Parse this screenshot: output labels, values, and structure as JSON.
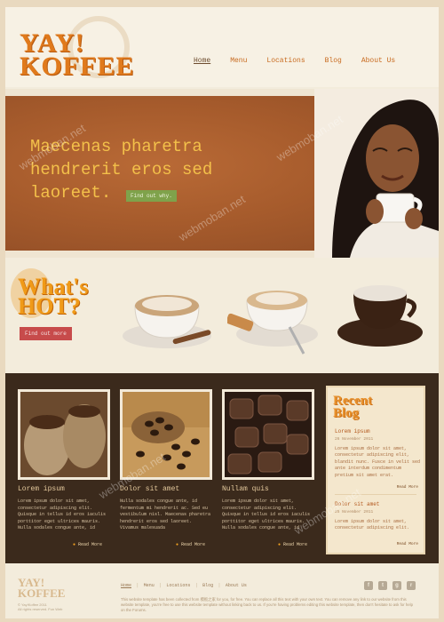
{
  "header": {
    "logo_line1": "YAY!",
    "logo_line2": "KOFFEE",
    "nav": [
      "Home",
      "Menu",
      "Locations",
      "Blog",
      "About Us"
    ]
  },
  "hero": {
    "headline": "Maecenas pharetra hendrerit eros sed laoreet.",
    "button": "Find out why."
  },
  "hot": {
    "title_line1": "What's",
    "title_line2": "HOT?",
    "button": "Find out more"
  },
  "cards": [
    {
      "title": "Lorem ipsum",
      "text": "Lorem ipsum dolor sit amet, consectetur adipiscing elit. Quisque in tellus id eros iaculis porttitor eget ultrices mauris. Nulla sodales congue ante, id",
      "more": "Read More"
    },
    {
      "title": "Dolor sit amet",
      "text": "Nulla sodales congue ante, id fermentum mi hendrerit ac. Sed eu vestibulum nisl. Maecenas pharetra hendrerit eros sed laoreet. Vivamus malesuada",
      "more": "Read More"
    },
    {
      "title": "Nullam quis",
      "text": "Lorem ipsum dolor sit amet, consectetur adipiscing elit. Quisque in tellus id eros iaculis porttitor eget ultrices mauris. Nulla sodales congue ante, id",
      "more": "Read More"
    }
  ],
  "blog": {
    "title_line1": "Recent",
    "title_line2": "Blog",
    "entries": [
      {
        "title": "Lorem ipsum",
        "date": "26 November 2011",
        "text": "Lorem ipsum dolor sit amet, consectetur adipiscing elit, blandit nunc. Fusce in velit sed ante interdum condimentum pretium sit amet erat.",
        "more": "Read More"
      },
      {
        "title": "Dolor sit amet",
        "date": "25 November 2011",
        "text": "Lorem ipsum dolor sit amet, consectetur adipiscing elit.",
        "more": "Read More"
      }
    ]
  },
  "footer": {
    "logo_line1": "YAY!",
    "logo_line2": "KOFFEE",
    "copyright_line1": "© Yay!Koffee 2011",
    "copyright_line2": "All rights reserved. Fun Web",
    "nav": [
      "Home",
      "Menu",
      "Locations",
      "Blog",
      "About Us"
    ],
    "note": "This website template has been collected from 模板之家 for you, for free. You can replace all this text with your own text. You can remove any link to our website from this website template, you're free to use this website template without linking back to us. If you're having problems editing this website template, then don't hesitate to ask for help on the Forums.",
    "social_icons": [
      "facebook-icon",
      "twitter-icon",
      "googleplus-icon",
      "rss-icon"
    ]
  },
  "watermark": "webmoban.net",
  "colors": {
    "accent_orange": "#e07a1c",
    "hero_brown": "#a65b2c",
    "dark_section": "#3b2a1c",
    "green_button": "#7fa24b",
    "red_button": "#c74b4b"
  }
}
